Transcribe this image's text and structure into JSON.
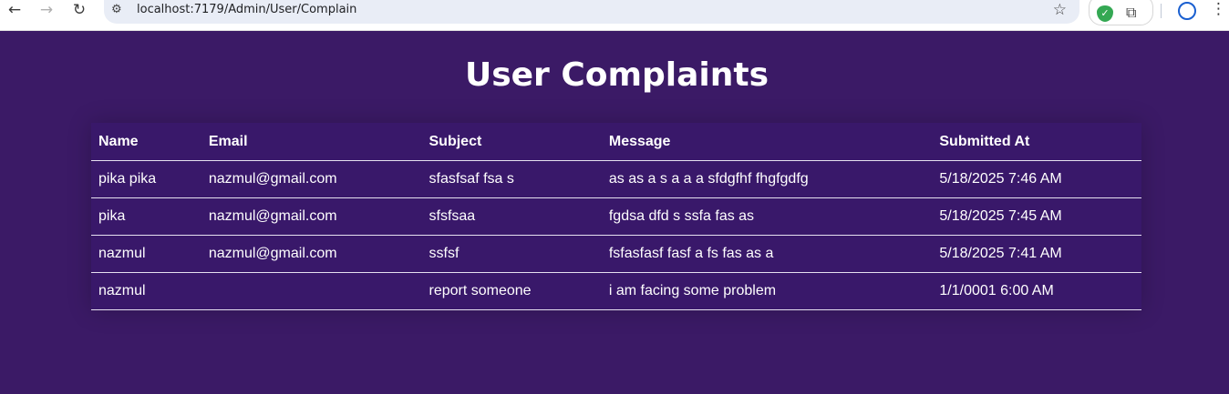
{
  "browser": {
    "url": "localhost:7179/Admin/User/Complain",
    "nav_back_icon": "←",
    "nav_forward_icon": "→",
    "reload_icon": "↻",
    "site_info_icon": "⚙",
    "star_icon": "☆",
    "shield_icon": "✓",
    "puzzle_icon": "⧉",
    "profile_icon": "●",
    "menu_icon": "⋮"
  },
  "page": {
    "title": "User Complaints"
  },
  "table": {
    "headers": [
      "Name",
      "Email",
      "Subject",
      "Message",
      "Submitted At"
    ],
    "rows": [
      [
        "pika pika",
        "nazmul@gmail.com",
        "sfasfsaf fsa s",
        "as as a s a a a sfdgfhf fhgfgdfg",
        "5/18/2025 7:46 AM"
      ],
      [
        "pika",
        "nazmul@gmail.com",
        "sfsfsaa",
        "fgdsa dfd s ssfa fas as",
        "5/18/2025 7:45 AM"
      ],
      [
        "nazmul",
        "nazmul@gmail.com",
        "ssfsf",
        "fsfasfasf fasf a fs fas as a",
        "5/18/2025 7:41 AM"
      ],
      [
        "nazmul",
        "",
        "report someone",
        "i am facing some problem",
        "1/1/0001 6:00 AM"
      ]
    ]
  },
  "colors": {
    "background": "#3b1a66",
    "text": "#ffffff",
    "row_border": "#e6e0f0"
  }
}
